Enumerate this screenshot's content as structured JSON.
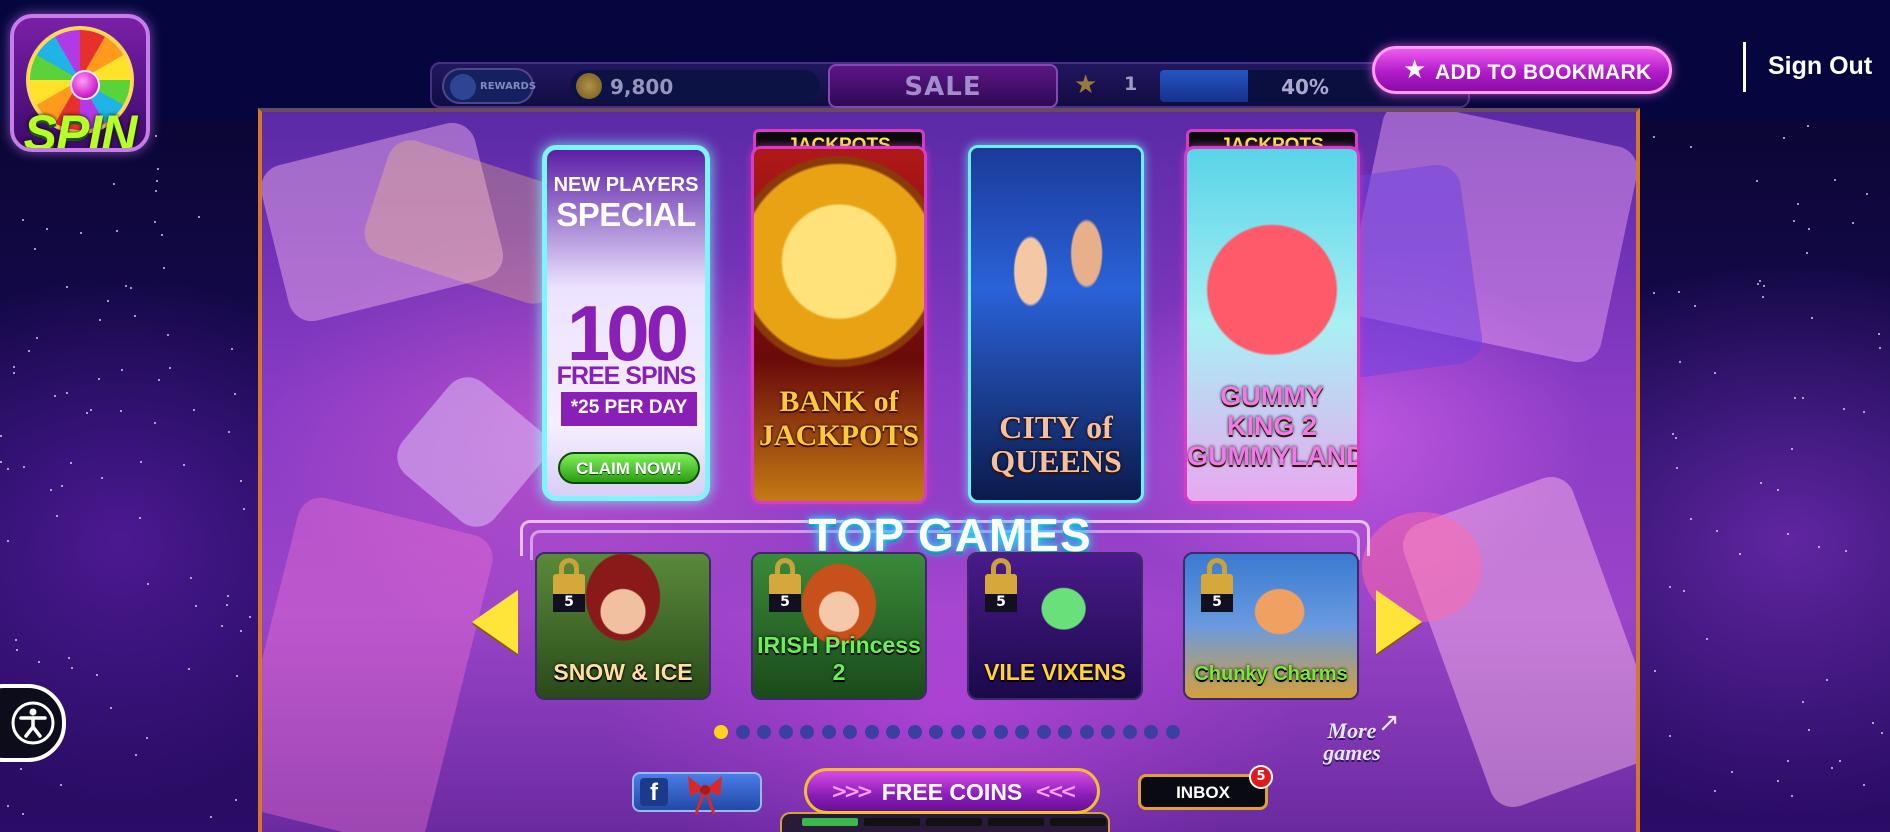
{
  "logo": {
    "text": "SPIN"
  },
  "hud": {
    "rewards_label": "REWARDS",
    "coins": "9,800",
    "sale_label": "SALE",
    "level": "1",
    "xp_percent": "40%",
    "xp_fraction": 0.4
  },
  "header": {
    "bookmark_label": "ADD TO BOOKMARK",
    "signout_label": "Sign Out"
  },
  "promo": {
    "line1": "NEW PLAYERS",
    "line2": "SPECIAL",
    "amount": "100",
    "spins_label": "FREE SPINS",
    "per_day": "*25 PER DAY",
    "claim_label": "CLAIM NOW!"
  },
  "featured": [
    {
      "tag": "JACKPOTS",
      "title": "BANK of JACKPOTS"
    },
    {
      "tag": "",
      "title": "CITY of QUEENS"
    },
    {
      "tag": "JACKPOTS",
      "title": "GUMMY KING 2 GUMMYLAND"
    }
  ],
  "section_title": "TOP GAMES",
  "top_games": [
    {
      "title": "SNOW & ICE",
      "lock_level": "5"
    },
    {
      "title": "IRISH Princess 2",
      "lock_level": "5"
    },
    {
      "title": "VILE VIXENS",
      "lock_level": "5"
    },
    {
      "title": "Chunky Charms",
      "lock_level": "5"
    }
  ],
  "pager": {
    "count": 22,
    "active": 0
  },
  "more_games_label": "More games",
  "bottom": {
    "free_coins_label": "FREE COINS",
    "inbox_label": "INBOX",
    "inbox_count": "5"
  },
  "colors": {
    "accent_magenta": "#b01cc8",
    "tile_glow": "#6cf0ff",
    "arrow_yellow": "#ffe43a",
    "top_bar": "#06063e"
  }
}
